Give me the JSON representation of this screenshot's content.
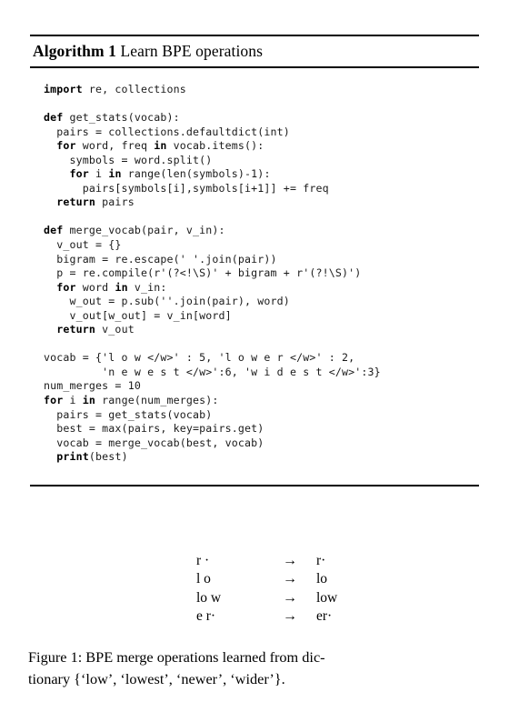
{
  "figure": {
    "algorithm": {
      "label": "Algorithm 1",
      "caption": "Learn BPE operations",
      "code_lines": [
        [
          {
            "t": "import",
            "b": true
          },
          {
            "t": " re, collections",
            "b": false
          }
        ],
        [],
        [
          {
            "t": "def",
            "b": true
          },
          {
            "t": " get_stats(vocab):",
            "b": false
          }
        ],
        [
          {
            "t": "  pairs = collections.defaultdict(int)",
            "b": false
          }
        ],
        [
          {
            "t": "  ",
            "b": false
          },
          {
            "t": "for",
            "b": true
          },
          {
            "t": " word, freq ",
            "b": false
          },
          {
            "t": "in",
            "b": true
          },
          {
            "t": " vocab.items():",
            "b": false
          }
        ],
        [
          {
            "t": "    symbols = word.split()",
            "b": false
          }
        ],
        [
          {
            "t": "    ",
            "b": false
          },
          {
            "t": "for",
            "b": true
          },
          {
            "t": " i ",
            "b": false
          },
          {
            "t": "in",
            "b": true
          },
          {
            "t": " range(len(symbols)-1):",
            "b": false
          }
        ],
        [
          {
            "t": "      pairs[symbols[i],symbols[i+1]] += freq",
            "b": false
          }
        ],
        [
          {
            "t": "  ",
            "b": false
          },
          {
            "t": "return",
            "b": true
          },
          {
            "t": " pairs",
            "b": false
          }
        ],
        [],
        [
          {
            "t": "def",
            "b": true
          },
          {
            "t": " merge_vocab(pair, v_in):",
            "b": false
          }
        ],
        [
          {
            "t": "  v_out = {}",
            "b": false
          }
        ],
        [
          {
            "t": "  bigram = re.escape(' '.join(pair))",
            "b": false
          }
        ],
        [
          {
            "t": "  p = re.compile(r'(?<!\\S)' + bigram + r'(?!\\S)')",
            "b": false
          }
        ],
        [
          {
            "t": "  ",
            "b": false
          },
          {
            "t": "for",
            "b": true
          },
          {
            "t": " word ",
            "b": false
          },
          {
            "t": "in",
            "b": true
          },
          {
            "t": " v_in:",
            "b": false
          }
        ],
        [
          {
            "t": "    w_out = p.sub(''.join(pair), word)",
            "b": false
          }
        ],
        [
          {
            "t": "    v_out[w_out] = v_in[word]",
            "b": false
          }
        ],
        [
          {
            "t": "  ",
            "b": false
          },
          {
            "t": "return",
            "b": true
          },
          {
            "t": " v_out",
            "b": false
          }
        ],
        [],
        [
          {
            "t": "vocab = {'l o w </w>' : 5, 'l o w e r </w>' : 2,",
            "b": false
          }
        ],
        [
          {
            "t": "         'n e w e s t </w>':6, 'w i d e s t </w>':3}",
            "b": false
          }
        ],
        [
          {
            "t": "num_merges = 10",
            "b": false
          }
        ],
        [
          {
            "t": "for",
            "b": true
          },
          {
            "t": " i ",
            "b": false
          },
          {
            "t": "in",
            "b": true
          },
          {
            "t": " range(num_merges):",
            "b": false
          }
        ],
        [
          {
            "t": "  pairs = get_stats(vocab)",
            "b": false
          }
        ],
        [
          {
            "t": "  best = max(pairs, key=pairs.get)",
            "b": false
          }
        ],
        [
          {
            "t": "  vocab = merge_vocab(best, vocab)",
            "b": false
          }
        ],
        [
          {
            "t": "  ",
            "b": false
          },
          {
            "t": "print",
            "b": true
          },
          {
            "t": "(best)",
            "b": false
          }
        ]
      ]
    },
    "merge_operations": {
      "arrow": "→",
      "rows": [
        {
          "source": "r ·",
          "target": "r·"
        },
        {
          "source": "l o",
          "target": "lo"
        },
        {
          "source": "lo w",
          "target": "low"
        },
        {
          "source": "e r·",
          "target": "er·"
        }
      ]
    },
    "caption": {
      "line1": "Figure 1: BPE merge operations learned from dic-",
      "line2": "tionary {‘low’, ‘lowest’, ‘newer’, ‘wider’}."
    }
  }
}
